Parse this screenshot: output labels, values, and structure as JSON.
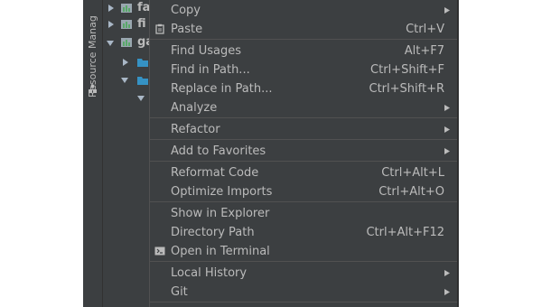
{
  "window": {
    "vertical_tab_label": "Resource Manag"
  },
  "tree": {
    "rows": [
      {
        "label": "fa"
      },
      {
        "label": "fi"
      },
      {
        "label": "ga"
      }
    ]
  },
  "menu": {
    "items": [
      {
        "label": "Copy"
      },
      {
        "label": "Paste",
        "shortcut": "Ctrl+V"
      },
      {
        "label": "Find Usages",
        "shortcut": "Alt+F7"
      },
      {
        "label": "Find in Path...",
        "shortcut": "Ctrl+Shift+F"
      },
      {
        "label": "Replace in Path...",
        "shortcut": "Ctrl+Shift+R"
      },
      {
        "label": "Analyze"
      },
      {
        "label": "Refactor"
      },
      {
        "label": "Add to Favorites"
      },
      {
        "label": "Reformat Code",
        "shortcut": "Ctrl+Alt+L"
      },
      {
        "label": "Optimize Imports",
        "shortcut": "Ctrl+Alt+O"
      },
      {
        "label": "Show in Explorer"
      },
      {
        "label": "Directory Path",
        "shortcut": "Ctrl+Alt+F12"
      },
      {
        "label": "Open in Terminal"
      },
      {
        "label": "Local History"
      },
      {
        "label": "Git"
      }
    ]
  },
  "icons": {
    "paste": "paste-icon",
    "terminal": "terminal-icon",
    "submenu": "submenu-arrow-icon",
    "resource_manager": "resource-manager-icon",
    "folder": "folder-icon",
    "module": "module-icon"
  },
  "colors": {
    "menu_background": "#3c3f41",
    "menu_text": "#bbbbbb",
    "separator": "#515151",
    "folder_blue": "#3592c4"
  }
}
